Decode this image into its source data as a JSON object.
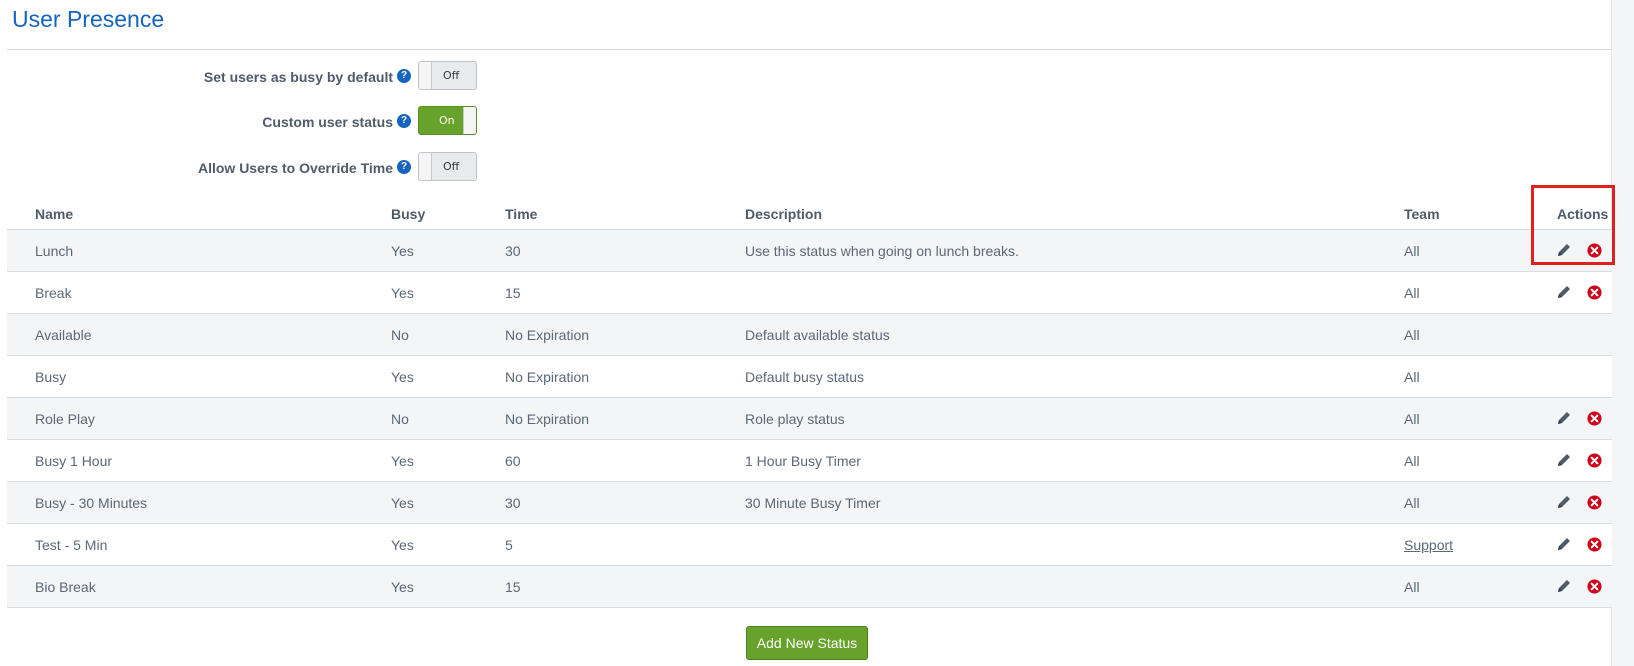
{
  "page": {
    "title": "User Presence"
  },
  "settings": [
    {
      "label": "Set users as busy by default",
      "state": "Off"
    },
    {
      "label": "Custom user status",
      "state": "On"
    },
    {
      "label": "Allow Users to Override Time",
      "state": "Off"
    }
  ],
  "table": {
    "headers": {
      "name": "Name",
      "busy": "Busy",
      "time": "Time",
      "description": "Description",
      "team": "Team",
      "actions": "Actions"
    },
    "rows": [
      {
        "name": "Lunch",
        "busy": "Yes",
        "time": "30",
        "description": "Use this status when going on lunch breaks.",
        "team": "All",
        "actions": true
      },
      {
        "name": "Break",
        "busy": "Yes",
        "time": "15",
        "description": "",
        "team": "All",
        "actions": true
      },
      {
        "name": "Available",
        "busy": "No",
        "time": "No Expiration",
        "description": "Default available status",
        "team": "All",
        "actions": false
      },
      {
        "name": "Busy",
        "busy": "Yes",
        "time": "No Expiration",
        "description": "Default busy status",
        "team": "All",
        "actions": false
      },
      {
        "name": "Role Play",
        "busy": "No",
        "time": "No Expiration",
        "description": "Role play status",
        "team": "All",
        "actions": true
      },
      {
        "name": "Busy 1 Hour",
        "busy": "Yes",
        "time": "60",
        "description": "1 Hour Busy Timer",
        "team": "All",
        "actions": true
      },
      {
        "name": "Busy - 30 Minutes",
        "busy": "Yes",
        "time": "30",
        "description": "30 Minute Busy Timer",
        "team": "All",
        "actions": true
      },
      {
        "name": "Test - 5 Min",
        "busy": "Yes",
        "time": "5",
        "description": "",
        "team": "Support",
        "team_link": true,
        "actions": true
      },
      {
        "name": "Bio Break",
        "busy": "Yes",
        "time": "15",
        "description": "",
        "team": "All",
        "actions": true
      }
    ]
  },
  "icons": {
    "edit": "pencil-icon",
    "delete": "delete-circle-icon",
    "help": "help-circle-icon"
  },
  "colors": {
    "accent": "#1565c0",
    "success": "#67a22b",
    "danger": "#d0021b",
    "highlight": "#e0201f"
  },
  "add_button": {
    "label": "Add New Status"
  }
}
